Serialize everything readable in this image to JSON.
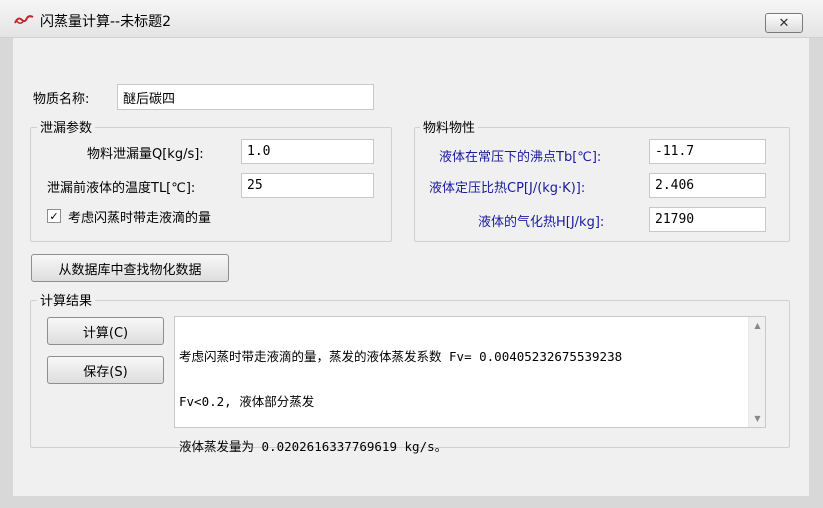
{
  "window": {
    "title": "闪蒸量计算--未标题2",
    "close_label": "✕"
  },
  "substance": {
    "label": "物质名称:",
    "value": "醚后碳四"
  },
  "leak_params": {
    "title": "泄漏参数",
    "rate_label": "物料泄漏量Q[kg/s]:",
    "rate_value": "1.0",
    "temp_label": "泄漏前液体的温度TL[℃]:",
    "temp_value": "25",
    "droplet_label": "考虑闪蒸时带走液滴的量",
    "droplet_checked": true,
    "check_mark": "✓"
  },
  "properties": {
    "title": "物料物性",
    "boiling_label": "液体在常压下的沸点Tb[℃]:",
    "boiling_value": "-11.7",
    "cp_label": "液体定压比热CP[J/(kg·K)]:",
    "cp_value": "2.406",
    "heat_label": "液体的气化热H[J/kg]:",
    "heat_value": "21790"
  },
  "lookup_button": "从数据库中查找物化数据",
  "results": {
    "title": "计算结果",
    "calc_button": "计算(C)",
    "save_button": "保存(S)",
    "lines": [
      "考虑闪蒸时带走液滴的量，蒸发的液体蒸发系数 Fv= 0.00405232675539238",
      "Fv<0.2, 液体部分蒸发",
      "液体蒸发量为 0.0202616337769619 kg/s。"
    ]
  }
}
